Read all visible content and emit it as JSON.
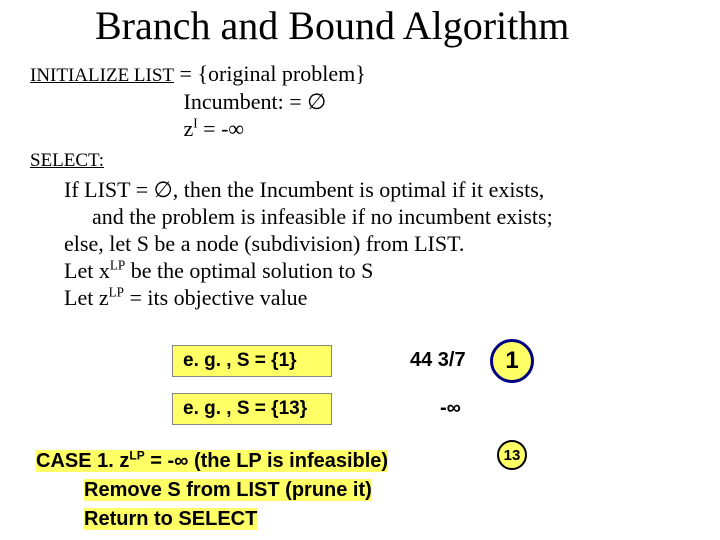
{
  "title": "Branch and Bound Algorithm",
  "init": {
    "label": "INITIALIZE LIST",
    "line1_rhs": "= {original problem}",
    "line2": "Incumbent: = ∅",
    "line3_pre": "z",
    "line3_sup": "I",
    "line3_post": " = -∞"
  },
  "select": {
    "label": "SELECT:",
    "l1": "If LIST = ∅, then the Incumbent is optimal if it exists,",
    "l2": "and the problem is infeasible if no incumbent exists;",
    "l3": "else, let S be a node (subdivision) from LIST.",
    "l4_pre": "Let x",
    "l4_sup": "LP",
    "l4_post": " be the optimal solution to S",
    "l5_pre": "Let z",
    "l5_sup": "LP",
    "l5_post": " = its objective value"
  },
  "examples": [
    {
      "box": "e. g. , S = {1}",
      "value": "44 3/7",
      "node": "1"
    },
    {
      "box": "e. g. , S = {13}",
      "value": "-∞",
      "node": "13"
    }
  ],
  "case1": {
    "head_pre": "CASE 1.    z",
    "head_sup": "LP",
    "head_post": " =  -∞ (the LP is infeasible)",
    "l2": "Remove S from LIST  (prune it)",
    "l3": "Return to SELECT"
  }
}
